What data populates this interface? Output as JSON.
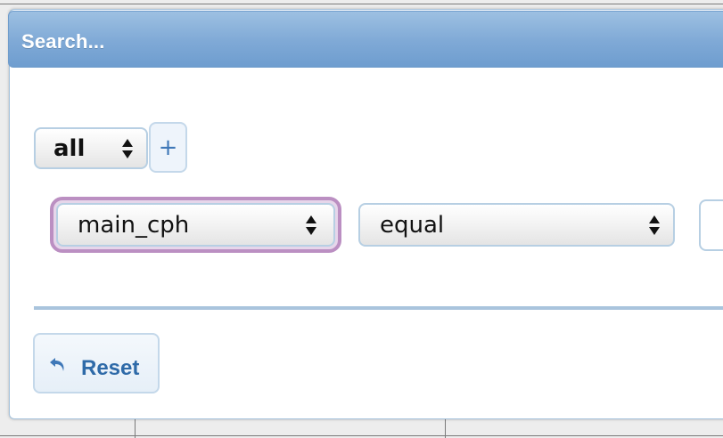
{
  "dialog": {
    "title": "Search..."
  },
  "group_operator": {
    "selected": "all"
  },
  "add_rule_button": {
    "label": "+"
  },
  "rule": {
    "field": "main_cph",
    "operator": "equal",
    "value": ""
  },
  "reset_button": {
    "label": "Reset",
    "icon": "undo-arrow-icon"
  },
  "colors": {
    "title_bar": "#7fa9d6",
    "focus_ring": "#bb8fc2",
    "button_text": "#2e6aa8"
  }
}
